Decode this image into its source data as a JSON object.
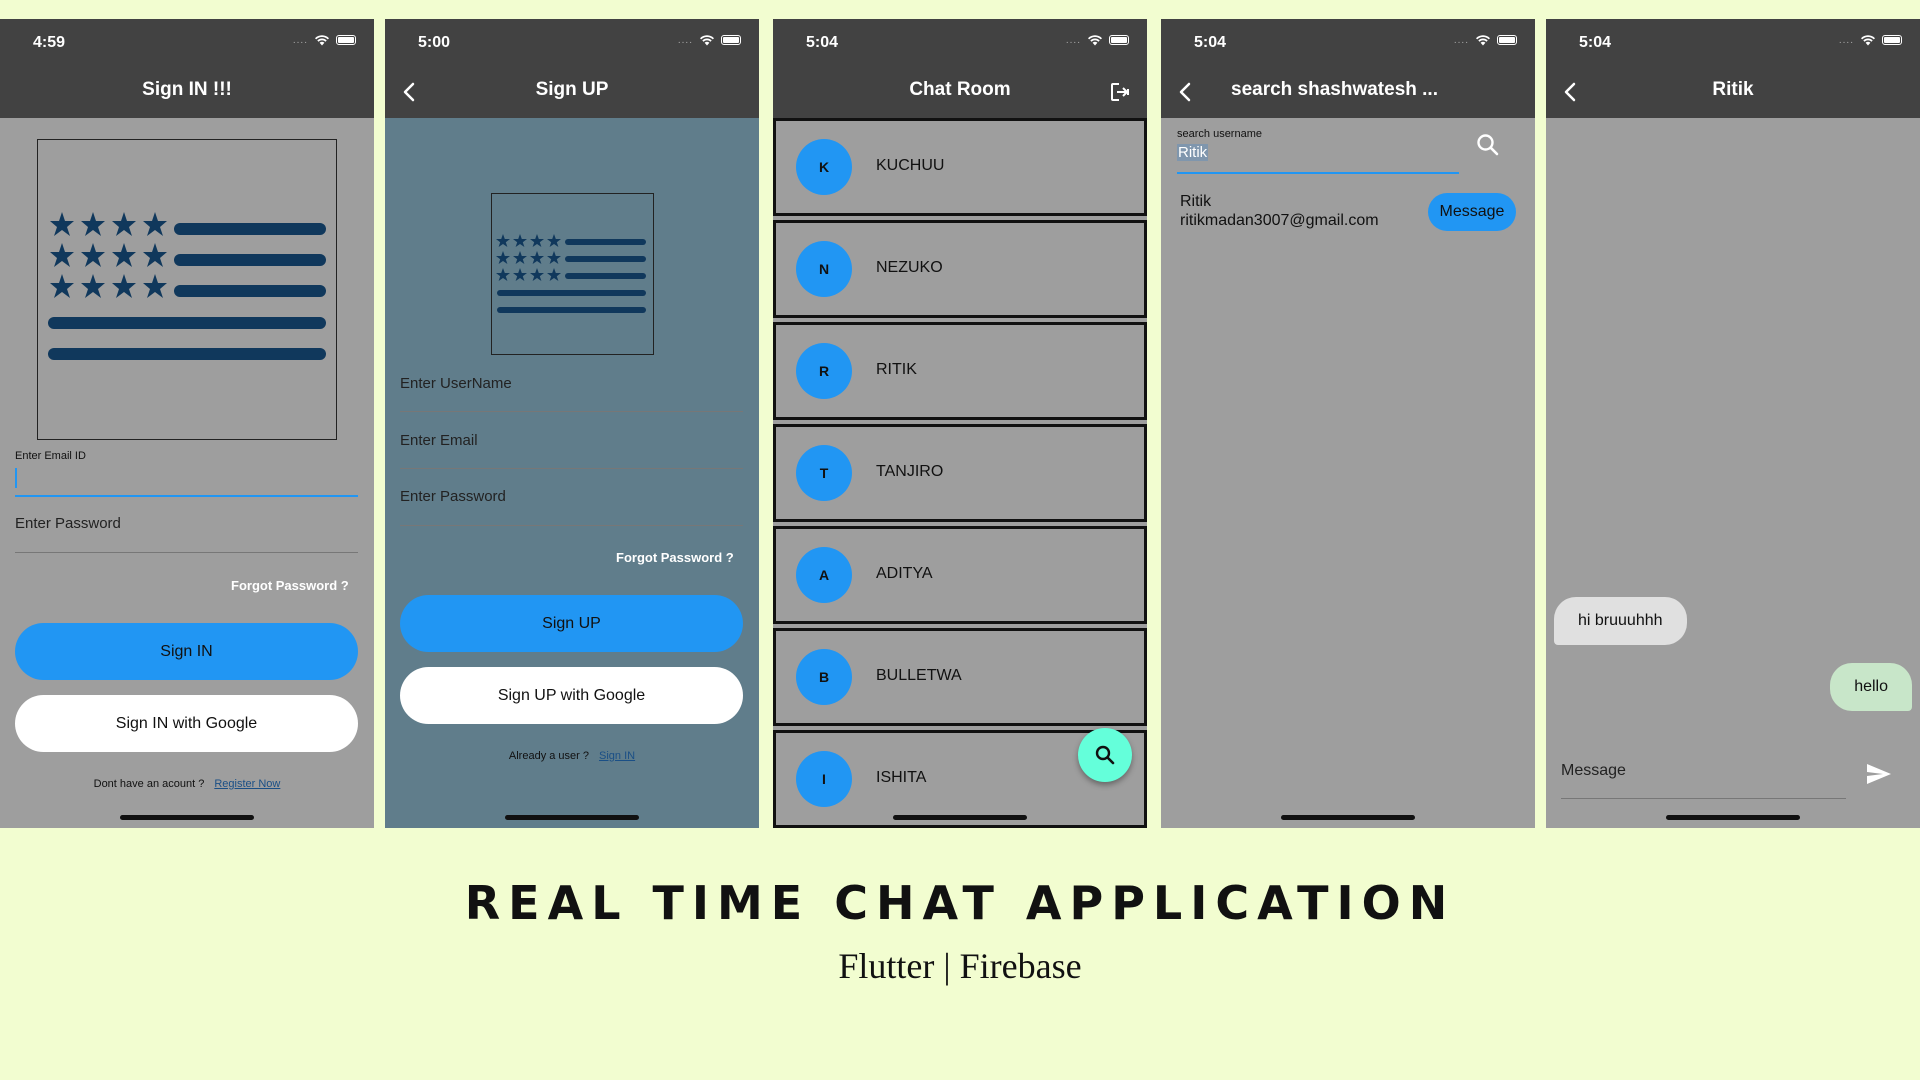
{
  "screens": {
    "signin": {
      "time": "4:59",
      "title": "Sign IN !!!",
      "email_label": "Enter Email ID",
      "password_placeholder": "Enter Password",
      "forgot": "Forgot Password ?",
      "signin_button": "Sign IN",
      "google_button": "Sign IN with Google",
      "footer_text": "Dont have an acount ?",
      "footer_link": "Register Now"
    },
    "signup": {
      "time": "5:00",
      "title": "Sign UP",
      "username_placeholder": "Enter UserName",
      "email_placeholder": "Enter Email",
      "password_placeholder": "Enter Password",
      "forgot": "Forgot Password ?",
      "signup_button": "Sign UP",
      "google_button": "Sign UP with Google",
      "footer_text": "Already a user ?",
      "footer_link": "Sign IN"
    },
    "chatroom": {
      "time": "5:04",
      "title": "Chat Room",
      "rooms": [
        {
          "initial": "K",
          "name": "KUCHUU"
        },
        {
          "initial": "N",
          "name": "NEZUKO"
        },
        {
          "initial": "R",
          "name": "RITIK"
        },
        {
          "initial": "T",
          "name": "TANJIRO"
        },
        {
          "initial": "A",
          "name": "ADITYA"
        },
        {
          "initial": "B",
          "name": "BULLETWA"
        },
        {
          "initial": "I",
          "name": "ISHITA"
        }
      ]
    },
    "search": {
      "time": "5:04",
      "title": "search shashwatesh ...",
      "search_label": "search username",
      "search_value": "Ritik",
      "result_name": "Ritik",
      "result_email": "ritikmadan3007@gmail.com",
      "message_button": "Message"
    },
    "conversation": {
      "time": "5:04",
      "title": "Ritik",
      "received": "hi bruuuhhh",
      "sent": "hello",
      "input_placeholder": "Message"
    }
  },
  "caption": {
    "title": "REAL TIME CHAT APPLICATION",
    "subtitle": "Flutter | Firebase"
  },
  "colors": {
    "background": "#f2fdd0",
    "appbar": "#424242",
    "accent_blue": "#2196f3",
    "fab": "#64ffda",
    "signup_bg": "#607d8b",
    "logo_navy": "#10385c"
  }
}
